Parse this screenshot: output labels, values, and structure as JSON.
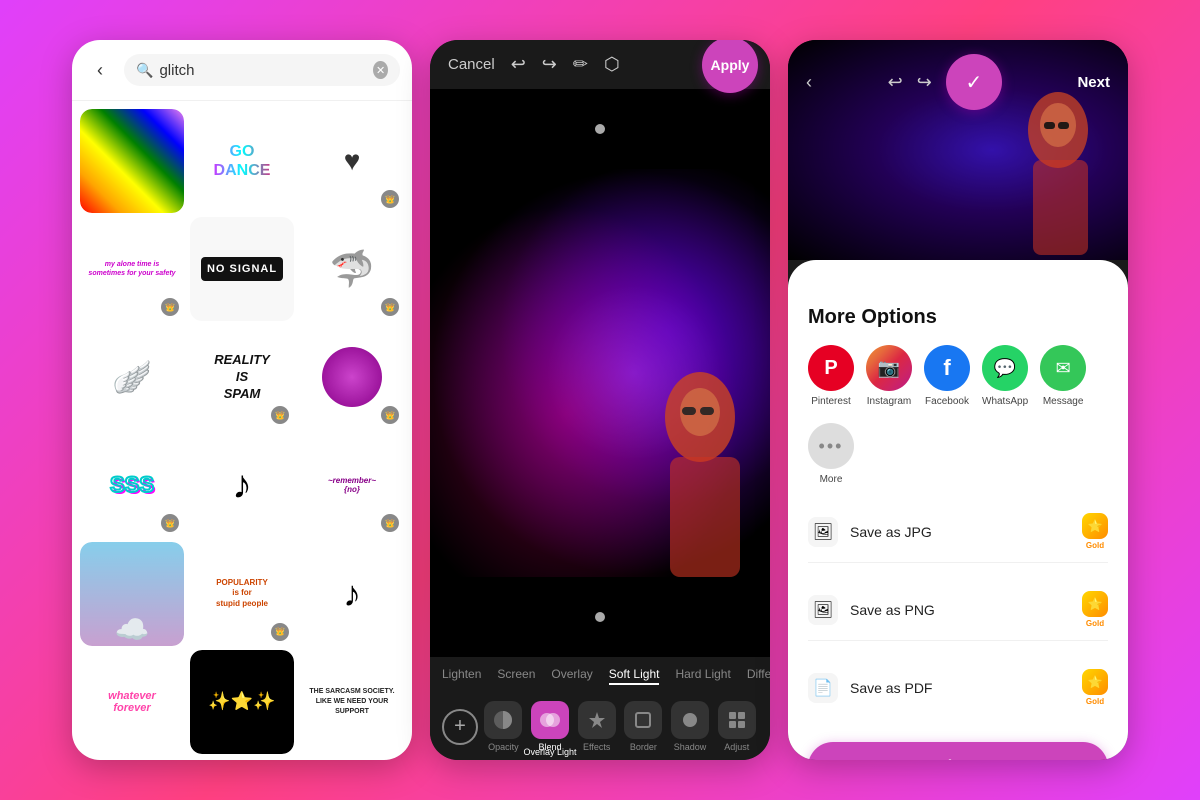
{
  "panel1": {
    "search_placeholder": "glitch",
    "stickers": [
      {
        "id": "rainbow",
        "type": "rainbow"
      },
      {
        "id": "go_dance",
        "label": "GO DANCE",
        "type": "text"
      },
      {
        "id": "heart",
        "type": "heart"
      },
      {
        "id": "my_alone_time",
        "label": "my alone time is sometimes for your safety",
        "type": "text_small"
      },
      {
        "id": "no_signal",
        "label": "NO SIGNAL",
        "type": "no_signal"
      },
      {
        "id": "shark",
        "type": "shark"
      },
      {
        "id": "wings",
        "type": "wings"
      },
      {
        "id": "reality_spam",
        "label": "REALITY IS SPAM",
        "type": "text_italic"
      },
      {
        "id": "purple_circle",
        "type": "circle"
      },
      {
        "id": "sss",
        "label": "SSS",
        "type": "sss"
      },
      {
        "id": "tiktok",
        "type": "tiktok"
      },
      {
        "id": "remember_no",
        "label": "~remember~ {no}",
        "type": "text_small"
      },
      {
        "id": "clouds",
        "type": "clouds"
      },
      {
        "id": "popularity",
        "label": "popularity is for stupid people",
        "type": "text_small"
      },
      {
        "id": "tiktok2",
        "type": "tiktok"
      },
      {
        "id": "whatever_forever",
        "label": "whatever forever",
        "type": "whatever"
      },
      {
        "id": "stars",
        "type": "stars"
      },
      {
        "id": "sarcasm",
        "label": "THE SARCASM SOCIETY. LIKE WE NEED YOUR SUPPORT",
        "type": "text_small"
      }
    ]
  },
  "panel2": {
    "cancel_label": "Cancel",
    "apply_label": "Apply",
    "blend_tabs": [
      {
        "label": "Lighten",
        "active": false
      },
      {
        "label": "Screen",
        "active": false
      },
      {
        "label": "Overlay",
        "active": false
      },
      {
        "label": "Soft Light",
        "active": true
      },
      {
        "label": "Hard Light",
        "active": false
      },
      {
        "label": "Difference",
        "active": false
      }
    ],
    "tools": [
      {
        "id": "opacity",
        "label": "Opacity",
        "icon": "◑",
        "active": false
      },
      {
        "id": "blend",
        "label": "Blend",
        "icon": "⬡",
        "active": true
      },
      {
        "id": "effects",
        "label": "Effects",
        "icon": "✦",
        "active": false
      },
      {
        "id": "border",
        "label": "Border",
        "icon": "⬜",
        "active": false
      },
      {
        "id": "shadow",
        "label": "Shadow",
        "icon": "●",
        "active": false
      },
      {
        "id": "adjust",
        "label": "Adjust",
        "icon": "⊞",
        "active": false
      }
    ],
    "overlay_light_label": "Overlay Light"
  },
  "panel3": {
    "next_label": "Next",
    "more_options_title": "More Options",
    "share_options": [
      {
        "id": "pinterest",
        "label": "Pinterest",
        "icon": "P",
        "color": "pinterest"
      },
      {
        "id": "instagram",
        "label": "Instagram",
        "icon": "📷",
        "color": "instagram"
      },
      {
        "id": "facebook",
        "label": "Facebook",
        "icon": "f",
        "color": "facebook"
      },
      {
        "id": "whatsapp",
        "label": "WhatsApp",
        "icon": "W",
        "color": "whatsapp"
      },
      {
        "id": "message",
        "label": "Message",
        "icon": "✉",
        "color": "message"
      },
      {
        "id": "more",
        "label": "More",
        "icon": "•••",
        "color": "more"
      }
    ],
    "save_options": [
      {
        "id": "jpg",
        "label": "Save as JPG",
        "icon": "🖼",
        "gold": true
      },
      {
        "id": "png",
        "label": "Save as PNG",
        "icon": "🖼",
        "gold": true
      },
      {
        "id": "pdf",
        "label": "Save as PDF",
        "icon": "📄",
        "gold": true
      }
    ],
    "close_label": "Close"
  }
}
